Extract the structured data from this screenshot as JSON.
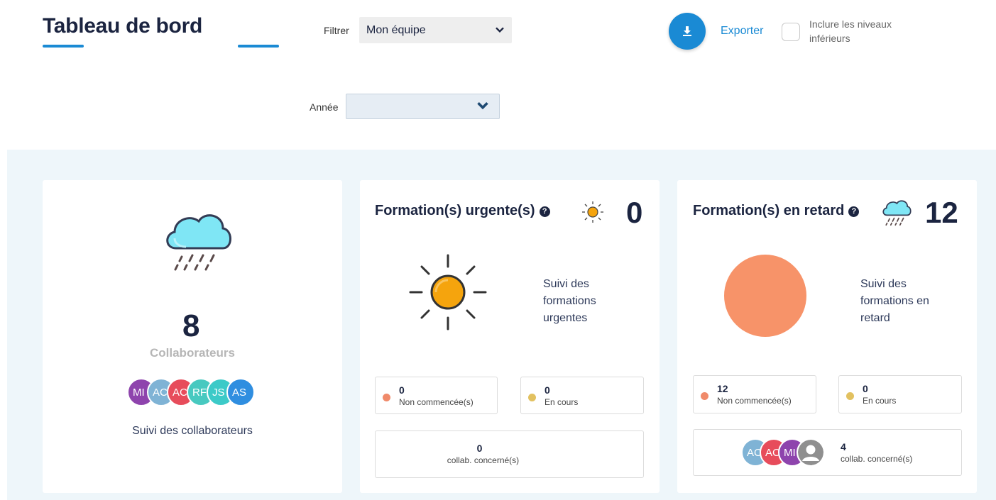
{
  "header": {
    "title": "Tableau de bord",
    "filter_label": "Filtrer",
    "filter_value": "Mon équipe",
    "year_label": "Année",
    "year_value": "",
    "export_label": "Exporter",
    "include_label": "Inclure les niveaux inférieurs"
  },
  "colors": {
    "accent": "#1a8ad4",
    "panel_bg": "#eef6fa",
    "overdue": "#f79369",
    "not_started_dot": "#f08a6a",
    "in_progress_dot": "#e2c160",
    "sun": "#f5a40d"
  },
  "collaborators": {
    "count": "8",
    "label": "Collaborateurs",
    "link": "Suivi des collaborateurs",
    "icon": "rain-cloud-icon",
    "avatars": [
      {
        "initials": "MI",
        "color": "#8e44ad"
      },
      {
        "initials": "AC",
        "color": "#7fb3d5"
      },
      {
        "initials": "AC",
        "color": "#e74c5b"
      },
      {
        "initials": "RF",
        "color": "#48c9c0"
      },
      {
        "initials": "JS",
        "color": "#3ccac8"
      },
      {
        "initials": "AS",
        "color": "#2f8ee0"
      }
    ]
  },
  "urgent": {
    "title": "Formation(s) urgente(s)",
    "count": "0",
    "icon": "sun-icon",
    "side_text": "Suivi des formations urgentes",
    "not_started": {
      "value": "0",
      "label": "Non commencée(s)"
    },
    "in_progress": {
      "value": "0",
      "label": "En cours"
    },
    "concerned": {
      "value": "0",
      "label": "collab. concerné(s)"
    }
  },
  "overdue": {
    "title": "Formation(s) en retard",
    "count": "12",
    "icon": "rain-cloud-icon",
    "side_text": "Suivi des formations en retard",
    "pie": {
      "not_started": 12,
      "in_progress": 0
    },
    "not_started": {
      "value": "12",
      "label": "Non commencée(s)"
    },
    "in_progress": {
      "value": "0",
      "label": "En cours"
    },
    "concerned": {
      "value": "4",
      "label": "collab. concerné(s)"
    },
    "avatars": [
      {
        "initials": "AC",
        "color": "#7fb3d5"
      },
      {
        "initials": "AC",
        "color": "#e74c5b"
      },
      {
        "initials": "MI",
        "color": "#8e44ad"
      },
      {
        "initials": "",
        "color": "#9b9b9b",
        "icon": "user-icon"
      }
    ]
  }
}
